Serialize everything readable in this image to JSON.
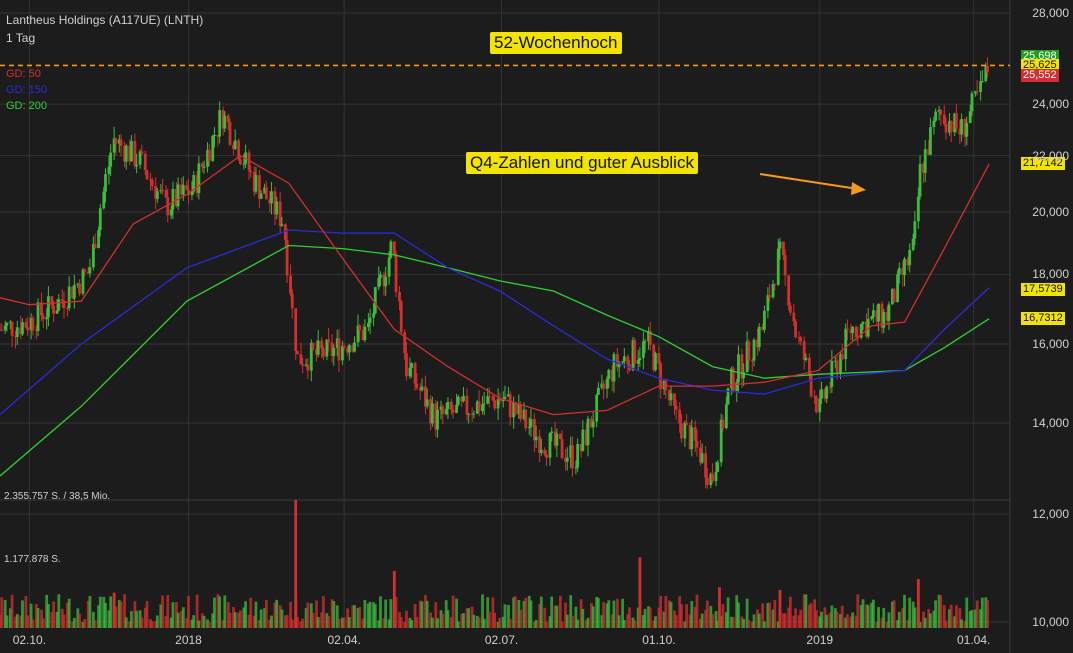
{
  "header": {
    "title": "Lantheus Holdings (A117UE) (LNTH)",
    "interval": "1 Tag"
  },
  "moving_averages": [
    {
      "label": "GD: 50",
      "color": "#d32f2f"
    },
    {
      "label": "GD: 150",
      "color": "#2b2bd6"
    },
    {
      "label": "GD: 200",
      "color": "#2fd12f"
    }
  ],
  "volume_labels": {
    "max": "2.355.757 S. / 38,5 Mio.",
    "mid": "1.177.878 S."
  },
  "annotations": {
    "high52": "52-Wochenhoch",
    "q4": "Q4-Zahlen und guter Ausblick"
  },
  "colors": {
    "background": "#1c1c1c",
    "up": "#3dbb3d",
    "down": "#d32f2f",
    "annotation": "#f2e400",
    "high_line": "#f29a1a"
  },
  "chart_data": {
    "type": "candlestick",
    "y_ticks": [
      "28,000",
      "24,000",
      "22,000",
      "20,000",
      "18,000",
      "16,000",
      "14,000",
      "12,000",
      "10,000"
    ],
    "y_range": [
      10,
      28
    ],
    "x_ticks": [
      "02.10.",
      "2018",
      "02.04.",
      "02.07.",
      "01.10.",
      "2019",
      "01.04."
    ],
    "price_series": [
      {
        "date": "2017-09-15",
        "price": 16.4
      },
      {
        "date": "2017-10-02",
        "price": 16.6
      },
      {
        "date": "2017-10-20",
        "price": 17.2
      },
      {
        "date": "2017-11-06",
        "price": 18.1
      },
      {
        "date": "2017-11-20",
        "price": 22.6
      },
      {
        "date": "2017-12-05",
        "price": 21.8
      },
      {
        "date": "2017-12-20",
        "price": 20.2
      },
      {
        "date": "2018-01-05",
        "price": 20.8
      },
      {
        "date": "2018-01-22",
        "price": 23.6
      },
      {
        "date": "2018-02-08",
        "price": 21.2
      },
      {
        "date": "2018-02-26",
        "price": 19.7
      },
      {
        "date": "2018-03-06",
        "price": 15.6
      },
      {
        "date": "2018-03-26",
        "price": 15.8
      },
      {
        "date": "2018-04-16",
        "price": 16.4
      },
      {
        "date": "2018-04-30",
        "price": 18.9
      },
      {
        "date": "2018-05-08",
        "price": 15.4
      },
      {
        "date": "2018-05-25",
        "price": 14.1
      },
      {
        "date": "2018-06-15",
        "price": 14.4
      },
      {
        "date": "2018-07-03",
        "price": 14.6
      },
      {
        "date": "2018-07-25",
        "price": 13.6
      },
      {
        "date": "2018-08-15",
        "price": 13.2
      },
      {
        "date": "2018-09-05",
        "price": 15.4
      },
      {
        "date": "2018-09-25",
        "price": 16.0
      },
      {
        "date": "2018-10-10",
        "price": 14.2
      },
      {
        "date": "2018-10-25",
        "price": 13.3
      },
      {
        "date": "2018-11-01",
        "price": 12.7
      },
      {
        "date": "2018-11-12",
        "price": 15.0
      },
      {
        "date": "2018-11-30",
        "price": 16.4
      },
      {
        "date": "2018-12-10",
        "price": 18.7
      },
      {
        "date": "2018-12-20",
        "price": 16.2
      },
      {
        "date": "2019-01-02",
        "price": 14.3
      },
      {
        "date": "2019-01-20",
        "price": 16.4
      },
      {
        "date": "2019-02-10",
        "price": 16.8
      },
      {
        "date": "2019-02-26",
        "price": 18.9
      },
      {
        "date": "2019-03-01",
        "price": 21.3
      },
      {
        "date": "2019-03-12",
        "price": 23.7
      },
      {
        "date": "2019-03-25",
        "price": 22.9
      },
      {
        "date": "2019-04-05",
        "price": 24.5
      },
      {
        "date": "2019-04-10",
        "price": 25.6
      }
    ],
    "ma50": [
      {
        "date": "2017-09-15",
        "price": 17.3
      },
      {
        "date": "2017-10-02",
        "price": 17.1
      },
      {
        "date": "2017-11-01",
        "price": 17.2
      },
      {
        "date": "2017-12-01",
        "price": 19.6
      },
      {
        "date": "2018-01-01",
        "price": 20.6
      },
      {
        "date": "2018-02-01",
        "price": 22.0
      },
      {
        "date": "2018-03-01",
        "price": 21.0
      },
      {
        "date": "2018-04-01",
        "price": 18.5
      },
      {
        "date": "2018-05-01",
        "price": 16.4
      },
      {
        "date": "2018-06-01",
        "price": 15.4
      },
      {
        "date": "2018-07-01",
        "price": 14.6
      },
      {
        "date": "2018-08-01",
        "price": 14.2
      },
      {
        "date": "2018-09-01",
        "price": 14.3
      },
      {
        "date": "2018-10-01",
        "price": 14.9
      },
      {
        "date": "2018-11-01",
        "price": 14.9
      },
      {
        "date": "2018-12-01",
        "price": 15.0
      },
      {
        "date": "2019-01-01",
        "price": 15.3
      },
      {
        "date": "2019-02-01",
        "price": 16.5
      },
      {
        "date": "2019-02-20",
        "price": 16.6
      },
      {
        "date": "2019-03-15",
        "price": 18.8
      },
      {
        "date": "2019-04-10",
        "price": 21.7
      }
    ],
    "ma150": [
      {
        "date": "2017-09-15",
        "price": 14.2
      },
      {
        "date": "2017-11-01",
        "price": 16.0
      },
      {
        "date": "2018-01-01",
        "price": 18.2
      },
      {
        "date": "2018-03-01",
        "price": 19.4
      },
      {
        "date": "2018-04-01",
        "price": 19.3
      },
      {
        "date": "2018-05-01",
        "price": 19.3
      },
      {
        "date": "2018-06-01",
        "price": 18.2
      },
      {
        "date": "2018-07-01",
        "price": 17.5
      },
      {
        "date": "2018-08-01",
        "price": 16.5
      },
      {
        "date": "2018-09-01",
        "price": 15.6
      },
      {
        "date": "2018-10-01",
        "price": 15.1
      },
      {
        "date": "2018-11-01",
        "price": 14.8
      },
      {
        "date": "2018-12-01",
        "price": 14.7
      },
      {
        "date": "2019-01-01",
        "price": 15.1
      },
      {
        "date": "2019-02-20",
        "price": 15.3
      },
      {
        "date": "2019-03-15",
        "price": 16.4
      },
      {
        "date": "2019-04-10",
        "price": 17.6
      }
    ],
    "ma200": [
      {
        "date": "2017-09-15",
        "price": 12.8
      },
      {
        "date": "2017-11-01",
        "price": 14.4
      },
      {
        "date": "2018-01-01",
        "price": 17.2
      },
      {
        "date": "2018-03-01",
        "price": 18.9
      },
      {
        "date": "2018-04-01",
        "price": 18.8
      },
      {
        "date": "2018-05-01",
        "price": 18.6
      },
      {
        "date": "2018-06-01",
        "price": 18.2
      },
      {
        "date": "2018-07-01",
        "price": 17.8
      },
      {
        "date": "2018-08-01",
        "price": 17.5
      },
      {
        "date": "2018-09-01",
        "price": 16.8
      },
      {
        "date": "2018-10-01",
        "price": 16.2
      },
      {
        "date": "2018-11-01",
        "price": 15.4
      },
      {
        "date": "2018-12-01",
        "price": 15.1
      },
      {
        "date": "2019-01-01",
        "price": 15.2
      },
      {
        "date": "2019-02-20",
        "price": 15.3
      },
      {
        "date": "2019-03-15",
        "price": 15.9
      },
      {
        "date": "2019-04-10",
        "price": 16.7
      }
    ],
    "high_52w": 25.625,
    "price_labels": [
      {
        "text": "25,698",
        "price": 25.698,
        "bg": "#1f9d1f",
        "fg": "#ffffff"
      },
      {
        "text": "25,625",
        "price": 25.625,
        "bg": "#f2e400",
        "fg": "#111111"
      },
      {
        "text": "25,552",
        "price": 25.552,
        "bg": "#d32f2f",
        "fg": "#ffffff"
      },
      {
        "text": "21,7142",
        "price": 21.7142,
        "bg": "#f2e400",
        "fg": "#111111"
      },
      {
        "text": "17,5739",
        "price": 17.5739,
        "bg": "#f2e400",
        "fg": "#111111"
      },
      {
        "text": "16,7312",
        "price": 16.7312,
        "bg": "#f2e400",
        "fg": "#111111"
      }
    ],
    "volume_max": 2355757,
    "volume_spikes": [
      {
        "date": "2018-03-05",
        "volume": 2355757
      },
      {
        "date": "2018-05-01",
        "volume": 1050000
      },
      {
        "date": "2018-09-20",
        "volume": 1300000
      },
      {
        "date": "2019-02-28",
        "volume": 900000
      },
      {
        "date": "2018-11-05",
        "volume": 750000
      },
      {
        "date": "2018-12-10",
        "volume": 700000
      },
      {
        "date": "2017-11-20",
        "volume": 650000
      }
    ]
  }
}
